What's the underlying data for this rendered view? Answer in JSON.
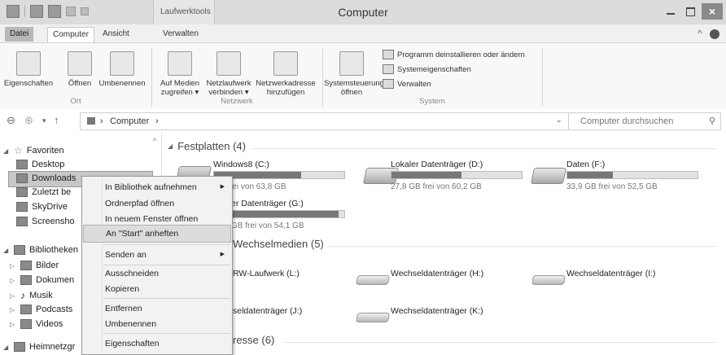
{
  "window": {
    "title": "Computer",
    "context_tab": "Laufwerktools",
    "close_glyph": "×"
  },
  "ribbon_tabs": [
    "Datei",
    "Computer",
    "Ansicht",
    "Verwalten"
  ],
  "ribbon": {
    "ort": {
      "label": "Ort",
      "buttons": [
        "Eigenschaften",
        "Öffnen",
        "Umbenennen"
      ]
    },
    "netzwerk": {
      "label": "Netzwerk",
      "btn1_l1": "Auf Medien",
      "btn1_l2": "zugreifen ▾",
      "btn2_l1": "Netzlaufwerk",
      "btn2_l2": "verbinden ▾",
      "btn3_l1": "Netzwerkadresse",
      "btn3_l2": "hinzufügen"
    },
    "system": {
      "label": "System",
      "btn_l1": "Systemsteuerung",
      "btn_l2": "öffnen",
      "small": [
        "Programm deinstallieren oder ändern",
        "Systemeigenschaften",
        "Verwalten"
      ]
    }
  },
  "address": {
    "crumb": "Computer",
    "sep": "›",
    "search_placeholder": "Computer durchsuchen"
  },
  "nav": {
    "favoriten": "Favoriten",
    "fav_items": [
      "Desktop",
      "Downloads",
      "Zuletzt be",
      "SkyDrive",
      "Screensho"
    ],
    "bibliotheken": "Bibliotheken",
    "lib_items": [
      "Bilder",
      "Dokumen",
      "Musik",
      "Podcasts",
      "Videos"
    ],
    "heimnetz": "Heimnetzgr"
  },
  "content": {
    "festplatten": "Festplatten (4)",
    "wechselmedien": "Wechselmedien (5)",
    "netzwerkadressen": "resse (6)",
    "drives": [
      {
        "name": "Windows8 (C:)",
        "free": "GB frei von 63,8 GB",
        "used_fraction": 0.67
      },
      {
        "name": "Lokaler Datenträger (D:)",
        "free": "27,8 GB frei von 60,2 GB",
        "used_fraction": 0.54
      },
      {
        "name": "Daten (F:)",
        "free": "33,9 GB frei von 52,5 GB",
        "used_fraction": 0.35
      },
      {
        "name": "er Datenträger (G:)",
        "free": "GB frei von 54,1 GB",
        "used_fraction": 0.95
      }
    ],
    "removable": [
      "RW-Laufwerk (L:)",
      "Wechseldatenträger (H:)",
      "Wechseldatenträger (I:)",
      "seldatenträger (J:)",
      "Wechseldatenträger (K:)"
    ]
  },
  "context_menu": {
    "items": [
      "In Bibliothek aufnehmen",
      "Ordnerpfad öffnen",
      "In neuem Fenster öffnen",
      "An \"Start\" anheften",
      "Senden an",
      "Ausschneiden",
      "Kopieren",
      "Entfernen",
      "Umbenennen",
      "Eigenschaften"
    ],
    "submenu_arrow": "▶"
  }
}
